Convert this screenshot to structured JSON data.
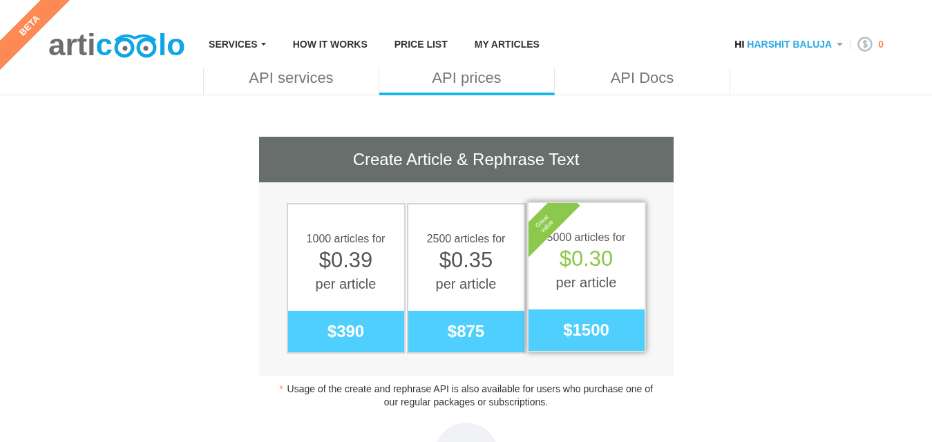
{
  "ribbon": "BETA",
  "logo": {
    "prefix": "arti",
    "blue_start": "c",
    "blue_end": "lo"
  },
  "nav": [
    {
      "label": "SERVICES",
      "dropdown": true
    },
    {
      "label": "HOW IT WORKS",
      "dropdown": false
    },
    {
      "label": "PRICE LIST",
      "dropdown": false
    },
    {
      "label": "MY ARTICLES",
      "dropdown": false
    }
  ],
  "user": {
    "greeting": "HI",
    "name": "HARSHIT BALUJA",
    "credits": "0"
  },
  "tabs": [
    {
      "label": "API services",
      "selected": false
    },
    {
      "label": "API prices",
      "selected": true
    },
    {
      "label": "API Docs",
      "selected": false
    }
  ],
  "pricing": {
    "title": "Create Article & Rephrase Text",
    "plans": [
      {
        "quantity": "1000 articles for",
        "unit_price": "$0.39",
        "unit": "per article",
        "total": "$390",
        "featured": false
      },
      {
        "quantity": "2500 articles for",
        "unit_price": "$0.35",
        "unit": "per article",
        "total": "$875",
        "featured": false
      },
      {
        "quantity": "5000 articles for",
        "unit_price": "$0.30",
        "unit": "per article",
        "total": "$1500",
        "featured": true,
        "badge": "Great value"
      }
    ]
  },
  "note": {
    "mark": "*",
    "text": "Usage of the create and rephrase API is also available for users who purchase one of our regular packages or subscriptions."
  }
}
